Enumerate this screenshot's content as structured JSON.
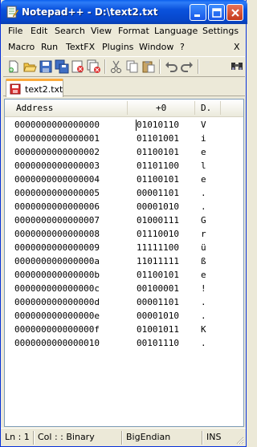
{
  "window": {
    "title": "Notepad++ - D:\\text2.txt"
  },
  "menu": {
    "row1": [
      "File",
      "Edit",
      "Search",
      "View",
      "Format",
      "Language",
      "Settings"
    ],
    "row2": [
      "Macro",
      "Run",
      "TextFX",
      "Plugins",
      "Window",
      "?"
    ],
    "close_x": "X"
  },
  "toolbar": {
    "icons": [
      "new-file-icon",
      "open-file-icon",
      "save-icon",
      "save-all-icon",
      "close-file-icon",
      "close-all-icon",
      "cut-icon",
      "copy-icon",
      "paste-icon",
      "undo-icon",
      "redo-icon",
      "find-icon"
    ]
  },
  "tab": {
    "label": "text2.txt"
  },
  "hex": {
    "header": {
      "address": "Address",
      "column": "+0",
      "dump": "D."
    },
    "rows": [
      {
        "addr": "0000000000000000",
        "bin": "01010110",
        "ch": "V"
      },
      {
        "addr": "0000000000000001",
        "bin": "01101001",
        "ch": "i"
      },
      {
        "addr": "0000000000000002",
        "bin": "01100101",
        "ch": "e"
      },
      {
        "addr": "0000000000000003",
        "bin": "01101100",
        "ch": "l"
      },
      {
        "addr": "0000000000000004",
        "bin": "01100101",
        "ch": "e"
      },
      {
        "addr": "0000000000000005",
        "bin": "00001101",
        "ch": "."
      },
      {
        "addr": "0000000000000006",
        "bin": "00001010",
        "ch": "."
      },
      {
        "addr": "0000000000000007",
        "bin": "01000111",
        "ch": "G"
      },
      {
        "addr": "0000000000000008",
        "bin": "01110010",
        "ch": "r"
      },
      {
        "addr": "0000000000000009",
        "bin": "11111100",
        "ch": "ü"
      },
      {
        "addr": "000000000000000a",
        "bin": "11011111",
        "ch": "ß"
      },
      {
        "addr": "000000000000000b",
        "bin": "01100101",
        "ch": "e"
      },
      {
        "addr": "000000000000000c",
        "bin": "00100001",
        "ch": "!"
      },
      {
        "addr": "000000000000000d",
        "bin": "00001101",
        "ch": "."
      },
      {
        "addr": "000000000000000e",
        "bin": "00001010",
        "ch": "."
      },
      {
        "addr": "000000000000000f",
        "bin": "01001011",
        "ch": "K"
      },
      {
        "addr": "0000000000000010",
        "bin": "00101110",
        "ch": "."
      }
    ]
  },
  "status": {
    "ln": "Ln : 1",
    "col": "Col : : Binary",
    "endian": "BigEndian",
    "mode": "INS"
  },
  "colors": {
    "title_blue": "#0A52DD",
    "tab_accent": "#FAAA3C",
    "chrome": "#ECE9D8"
  }
}
